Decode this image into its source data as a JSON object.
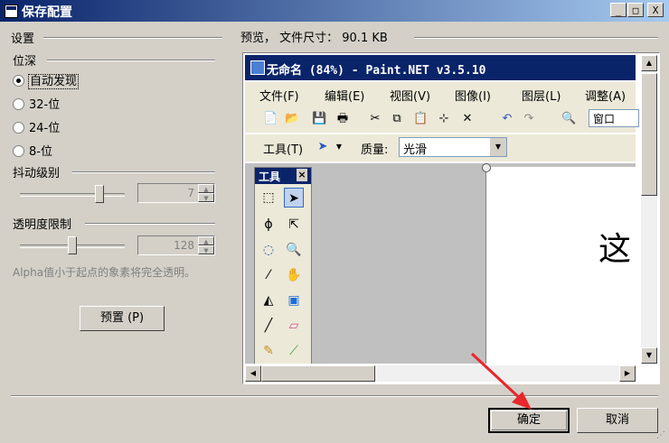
{
  "window": {
    "title": "保存配置",
    "btn_min": "_",
    "btn_max": "□",
    "btn_close": "X"
  },
  "settings": {
    "title": "设置",
    "bit_depth": {
      "title": "位深",
      "options": [
        {
          "label": "自动发现",
          "selected": true
        },
        {
          "label": "32-位",
          "selected": false
        },
        {
          "label": "24-位",
          "selected": false
        },
        {
          "label": "8-位",
          "selected": false
        }
      ]
    },
    "dither": {
      "title": "抖动级别",
      "value": "7",
      "level_fraction": 0.78
    },
    "transparency": {
      "title": "透明度限制",
      "value": "128",
      "level_fraction": 0.5
    },
    "hint": "Alpha值小于起点的象素将完全透明。",
    "preset_button": "预置 (P)"
  },
  "preview": {
    "label": "预览， 文件尺寸： 90.1 KB",
    "app_title": "无命名 (84%) - Paint.NET v3.5.10",
    "menu": [
      "文件(F)",
      "编辑(E)",
      "视图(V)",
      "图像(I)",
      "图层(L)",
      "调整(A)"
    ],
    "zoom_field": "窗口",
    "tool_label": "工具(T)",
    "quality_label": "质量:",
    "quality_value": "光滑",
    "tools_panel_title": "工具",
    "tools_close": "×",
    "canvas_text": "这"
  },
  "footer": {
    "ok": "确定",
    "cancel": "取消"
  },
  "colors": {
    "titlebar": "#0a246a",
    "face": "#d4d0c8",
    "arrow": "#e8262c",
    "canvas_text": "#e8262c"
  }
}
